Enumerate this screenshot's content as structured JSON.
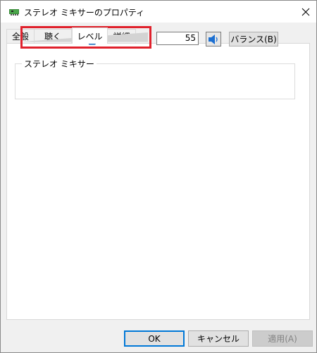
{
  "window": {
    "title": "ステレオ ミキサーのプロパティ"
  },
  "tabs": [
    {
      "label": "全般"
    },
    {
      "label": "聴く"
    },
    {
      "label": "レベル"
    },
    {
      "label": "詳細"
    }
  ],
  "active_tab": "レベル",
  "level_group": {
    "label": "ステレオ ミキサー",
    "slider_value": 55,
    "value_text": "55",
    "balance_label": "バランス(B)"
  },
  "buttons": {
    "ok": "OK",
    "cancel": "キャンセル",
    "apply": "適用(A)"
  },
  "colors": {
    "accent": "#0078d7",
    "highlight": "#e0212c"
  }
}
